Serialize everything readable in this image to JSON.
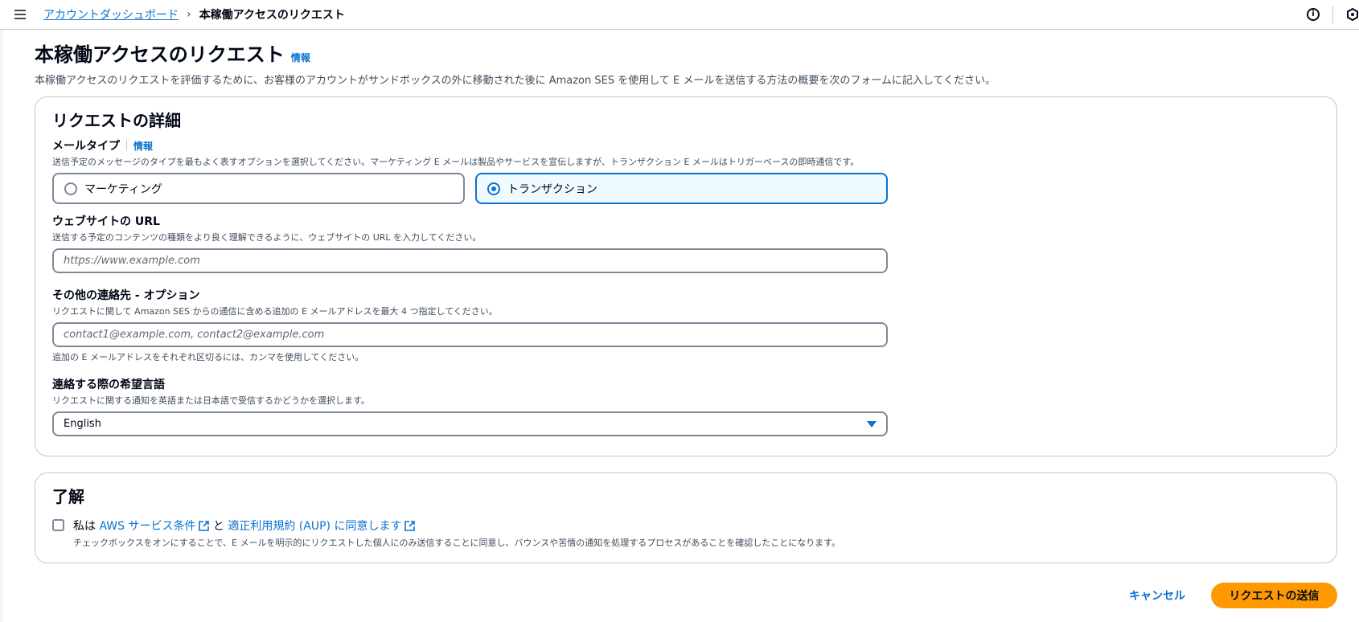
{
  "breadcrumb": {
    "parent": "アカウントダッシュボード",
    "current": "本稼働アクセスのリクエスト"
  },
  "page": {
    "title": "本稼働アクセスのリクエスト",
    "info_label": "情報",
    "description": "本稼働アクセスのリクエストを評価するために、お客様のアカウントがサンドボックスの外に移動された後に Amazon SES を使用して E メールを送信する方法の概要を次のフォームに記入してください。"
  },
  "details": {
    "title": "リクエストの詳細",
    "mail_type": {
      "label": "メールタイプ",
      "info_label": "情報",
      "description": "送信予定のメッセージのタイプを最もよく表すオプションを選択してください。マーケティング E メールは製品やサービスを宣伝しますが、トランザクション E メールはトリガーベースの即時通信です。",
      "options": [
        {
          "label": "マーケティング",
          "selected": false
        },
        {
          "label": "トランザクション",
          "selected": true
        }
      ]
    },
    "website": {
      "label": "ウェブサイトの URL",
      "description": "送信する予定のコンテンツの種類をより良く理解できるように、ウェブサイトの URL を入力してください。",
      "placeholder": "https://www.example.com",
      "value": ""
    },
    "contacts": {
      "label": "その他の連絡先 - オプション",
      "description": "リクエストに関して Amazon SES からの通信に含める追加の E メールアドレスを最大 4 つ指定してください。",
      "placeholder": "contact1@example.com, contact2@example.com",
      "value": "",
      "hint": "追加の E メールアドレスをそれぞれ区切るには、カンマを使用してください。"
    },
    "language": {
      "label": "連絡する際の希望言語",
      "description": "リクエストに関する通知を英語または日本語で受信するかどうかを選択します。",
      "selected": "English"
    }
  },
  "acknowledge": {
    "title": "了解",
    "prefix": "私は",
    "terms_link": "AWS サービス条件",
    "conjunction": "と",
    "aup_link": "適正利用規約 (AUP) に同意します",
    "description": "チェックボックスをオンにすることで、E メールを明示的にリクエストした個人にのみ送信することに同意し、バウンスや苦情の通知を処理するプロセスがあることを確認したことになります。",
    "checked": false
  },
  "footer": {
    "cancel_label": "キャンセル",
    "submit_label": "リクエストの送信"
  },
  "icons": {
    "menu": "hamburger-menu-icon",
    "separator": "chevron-right-icon",
    "info": "info-circle-icon",
    "notifications": "notification-hex-icon",
    "external": "external-link-icon",
    "dropdown": "caret-down-icon"
  },
  "colors": {
    "link": "#0972d3",
    "primary_button": "#ff9900",
    "selected_tile_bg": "#f0fbff",
    "border": "#7d8998"
  }
}
